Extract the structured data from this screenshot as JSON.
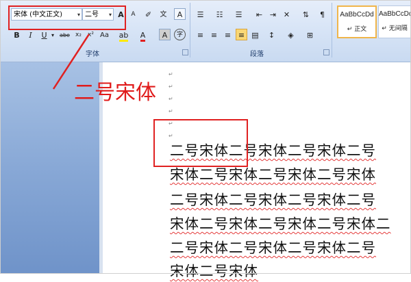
{
  "ribbon": {
    "font_group": {
      "label": "字体",
      "font_name": "宋体 (中文正文)",
      "font_size": "二号",
      "grow_font": "A",
      "shrink_font": "A",
      "bold": "B",
      "italic": "I",
      "underline": "U",
      "strikethrough": "abe",
      "subscript": "x₂",
      "superscript": "x²",
      "change_case": "Aa",
      "font_color": "A",
      "char_shading": "A",
      "enclose": "字"
    },
    "paragraph_group": {
      "label": "段落"
    },
    "styles": [
      {
        "sample": "AaBbCcDd",
        "name": "↵ 正文"
      },
      {
        "sample": "AaBbCcDd",
        "name": "↵ 无间隔"
      }
    ]
  },
  "callout": {
    "text": "二号宋体"
  },
  "document": {
    "lines": [
      "二号宋体二号宋体二号宋体二号",
      "宋体二号宋体二号宋体二号宋体",
      "二号宋体二号宋体二号宋体二号",
      "宋体二号宋体二号宋体二号宋体二",
      "二号宋体二号宋体二号宋体二号",
      "宋体二号宋体"
    ],
    "paragraph_mark": "↵"
  },
  "colors": {
    "highlight": "#e02020",
    "ribbon": "#d4e2f5",
    "accent": "#f0b54a"
  }
}
